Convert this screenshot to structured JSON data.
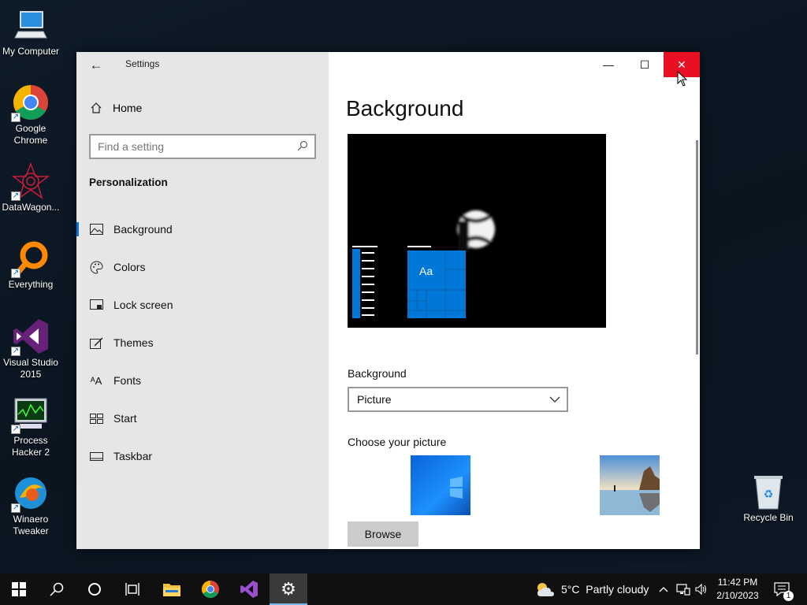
{
  "desktop": {
    "icons": [
      {
        "label": "My Computer",
        "icon": "computer-icon"
      },
      {
        "label": "Google\nChrome",
        "icon": "chrome-icon"
      },
      {
        "label": "DataWagon...",
        "icon": "datawagon-icon"
      },
      {
        "label": "Everything",
        "icon": "everything-icon"
      },
      {
        "label": "Visual Studio\n2015",
        "icon": "visual-studio-icon"
      },
      {
        "label": "Process\nHacker 2",
        "icon": "process-hacker-icon"
      },
      {
        "label": "Winaero\nTweaker",
        "icon": "winaero-icon"
      },
      {
        "label": "Recycle Bin",
        "icon": "recycle-bin-icon"
      }
    ]
  },
  "window": {
    "title": "Settings",
    "controls": {
      "minimize": "—",
      "maximize": "☐",
      "close": "✕"
    }
  },
  "sidebar": {
    "home_label": "Home",
    "search_placeholder": "Find a setting",
    "category": "Personalization",
    "items": [
      {
        "label": "Background",
        "icon": "image-icon",
        "selected": true
      },
      {
        "label": "Colors",
        "icon": "palette-icon",
        "selected": false
      },
      {
        "label": "Lock screen",
        "icon": "lock-screen-icon",
        "selected": false
      },
      {
        "label": "Themes",
        "icon": "brush-icon",
        "selected": false
      },
      {
        "label": "Fonts",
        "icon": "font-icon",
        "selected": false
      },
      {
        "label": "Start",
        "icon": "start-icon",
        "selected": false
      },
      {
        "label": "Taskbar",
        "icon": "taskbar-icon",
        "selected": false
      }
    ]
  },
  "main": {
    "heading": "Background",
    "preview_tile_text": "Aa",
    "background_label": "Background",
    "background_value": "Picture",
    "choose_label": "Choose your picture",
    "browse_label": "Browse"
  },
  "taskbar": {
    "weather": "5°C  Partly cloudy",
    "time": "11:42 PM",
    "date": "2/10/2023",
    "notification_count": "1",
    "accent": "#0078d7"
  }
}
